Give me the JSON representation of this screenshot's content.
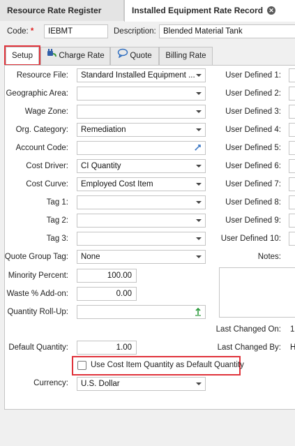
{
  "doc_tabs": [
    {
      "label": "Resource Rate Register"
    },
    {
      "label": "Installed Equipment Rate Record"
    }
  ],
  "header": {
    "code_label": "Code:",
    "code_value": "IEBMT",
    "description_label": "Description:",
    "description_value": "Blended Material Tank"
  },
  "sub_tabs": [
    {
      "label": "Setup"
    },
    {
      "label": "Charge Rate",
      "icon": "plug-icon"
    },
    {
      "label": "Quote",
      "icon": "speech-bubble-icon"
    },
    {
      "label": "Billing Rate"
    }
  ],
  "form": {
    "resource_file": {
      "label": "Resource File:",
      "value": "Standard Installed Equipment ..."
    },
    "geographic_area": {
      "label": "Geographic Area:",
      "value": ""
    },
    "wage_zone": {
      "label": "Wage Zone:",
      "value": ""
    },
    "org_category": {
      "label": "Org. Category:",
      "value": "Remediation"
    },
    "account_code": {
      "label": "Account Code:",
      "value": ""
    },
    "cost_driver": {
      "label": "Cost Driver:",
      "value": "CI Quantity"
    },
    "cost_curve": {
      "label": "Cost Curve:",
      "value": "Employed Cost Item"
    },
    "tag1": {
      "label": "Tag 1:",
      "value": ""
    },
    "tag2": {
      "label": "Tag 2:",
      "value": ""
    },
    "tag3": {
      "label": "Tag 3:",
      "value": ""
    },
    "quote_group_tag": {
      "label": "Quote Group Tag:",
      "value": "None"
    },
    "minority_percent": {
      "label": "Minority Percent:",
      "value": "100.00"
    },
    "waste_addon": {
      "label": "Waste % Add-on:",
      "value": "0.00"
    },
    "quantity_rollup": {
      "label": "Quantity Roll-Up:",
      "value": ""
    },
    "default_quantity": {
      "label": "Default Quantity:",
      "value": "1.00"
    },
    "use_ci_quantity": {
      "label": "Use Cost Item Quantity as Default Quantity",
      "checked": false
    },
    "currency": {
      "label": "Currency:",
      "value": "U.S. Dollar"
    }
  },
  "right": {
    "user_defined": [
      "User Defined 1:",
      "User Defined 2:",
      "User Defined 3:",
      "User Defined 4:",
      "User Defined 5:",
      "User Defined 6:",
      "User Defined 7:",
      "User Defined 8:",
      "User Defined 9:",
      "User Defined 10:"
    ],
    "notes_label": "Notes:",
    "last_changed_on_label": "Last Changed On:",
    "last_changed_on_value": "1",
    "last_changed_by_label": "Last Changed By:",
    "last_changed_by_value": "H"
  },
  "colors": {
    "highlight": "#e0323a",
    "required": "#e02020"
  }
}
